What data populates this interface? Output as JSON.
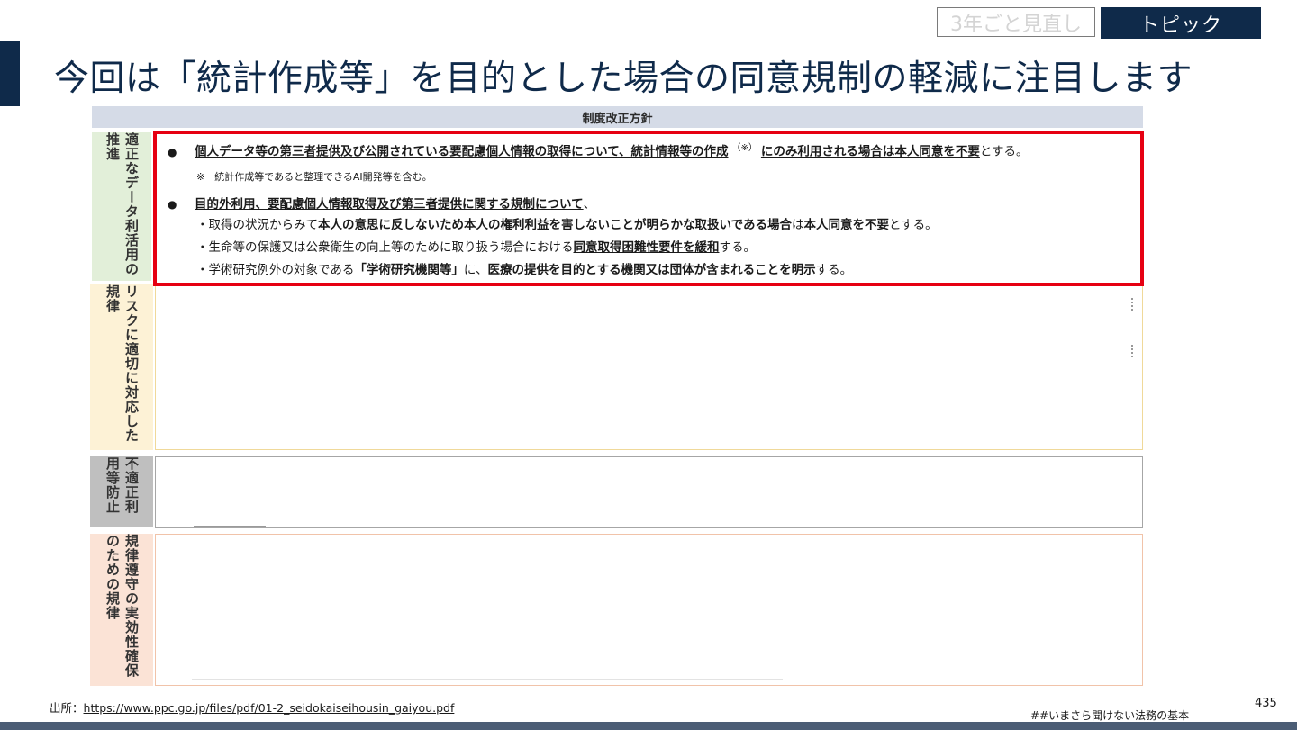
{
  "header": {
    "tag_outline": "3年ごと見直し",
    "tag_filled": "トピック",
    "title": "今回は「統計作成等」を目的とした場合の同意規制の軽減に注目します"
  },
  "table": {
    "header": "制度改正方針",
    "rows": [
      {
        "label": "適正なデータ利活用の推進",
        "color": "#e2efd9"
      },
      {
        "label": "リスクに適切に対応した規律",
        "color": "#fdf2d6"
      },
      {
        "label": "不適正利用等防止",
        "color": "#bfbfbf"
      },
      {
        "label": "規律遵守の実効性確保のための規律",
        "color": "#fbe3d6"
      }
    ],
    "highlight_color": "#e60012",
    "content": {
      "bullet1": {
        "bullet": "●",
        "main": "個人データ等の第三者提供及び公開されている要配慮個人情報の取得について、統計情報等の作成",
        "sup": "（※）",
        "tail_bold": "にのみ利用される場合は本人同意を不要",
        "tail": "とする。"
      },
      "note": "※　統計作成等であると整理できるAI開発等を含む。",
      "bullet2": {
        "bullet": "●",
        "main": "目的外利用、要配慮個人情報取得及び第三者提供に関する規制について",
        "tail": "、"
      },
      "sub1": {
        "lead": "・取得の状況からみて",
        "bold1": "本人の意思に反しないため本人の権利利益を害しないことが明らかな取扱いである場合",
        "mid": "は",
        "bold2": "本人同意を不要",
        "tail": "とする。"
      },
      "sub2": {
        "lead": "・生命等の保護又は公衆衛生の向上等のために取り扱う場合における",
        "bold": "同意取得困難性要件を緩和",
        "tail": "する。"
      },
      "sub3": {
        "lead": "・学術研究例外の対象である",
        "bold1": "「学術研究機関等」",
        "mid": "に、",
        "bold2": "医療の提供を目的とする機関又は団体が含まれることを明示",
        "tail": "する。"
      }
    }
  },
  "footer": {
    "source_label": "出所：",
    "source_url": "https://www.ppc.go.jp/files/pdf/01-2_seidokaiseihousin_gaiyou.pdf",
    "hashtag": "##いまさら聞けない法務の基本",
    "page_number": "435"
  },
  "colors": {
    "navy": "#0f2a4a",
    "table_header_bg": "#d5dbe7",
    "bottom_bar": "#4b5d75"
  }
}
